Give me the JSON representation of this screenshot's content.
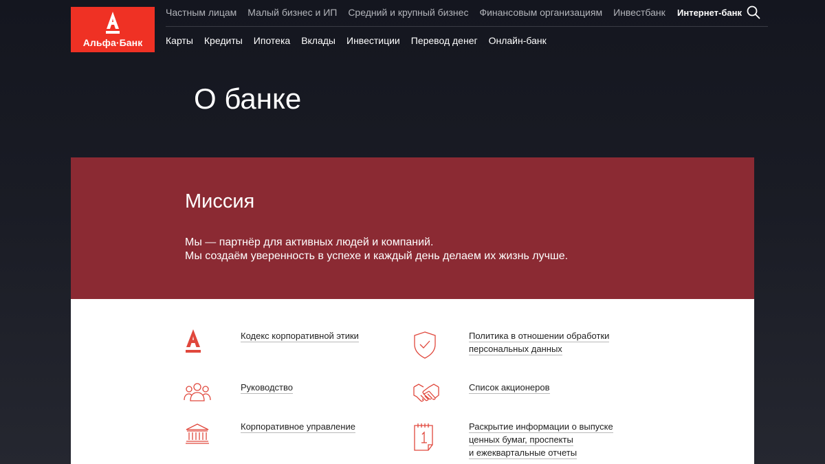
{
  "logo": {
    "text": "Альфа·Банк"
  },
  "nav_top": [
    "Частным лицам",
    "Малый бизнес и ИП",
    "Средний и крупный бизнес",
    "Финансовым организациям",
    "Инвестбанк"
  ],
  "internet_bank": "Интернет-банк",
  "nav_sub": [
    "Карты",
    "Кредиты",
    "Ипотека",
    "Вклады",
    "Инвестиции",
    "Перевод денег",
    "Онлайн-банк"
  ],
  "page_title": "О банке",
  "mission": {
    "heading": "Миссия",
    "line1": "Мы — партнёр для активных людей и компаний.",
    "line2": "Мы создаём уверенность в успехе и каждый день делаем их жизнь лучше."
  },
  "links": {
    "ethics": "Кодекс корпоративной этики",
    "management": "Руководство",
    "governance": "Корпоративное управление",
    "privacy_l1": "Политика в отношении обработки",
    "privacy_l2": "персональных данных",
    "shareholders": "Список акционеров",
    "disclosure_l1": "Раскрытие информации о выпуске",
    "disclosure_l2": "ценных бумаг, проспекты",
    "disclosure_l3": "и ежеквартальные отчеты"
  },
  "colors": {
    "brand_red": "#ef3124",
    "mission_bg": "#8b2a33",
    "icon_red": "#e0473c"
  },
  "icons": [
    "alfa-a-icon",
    "people-icon",
    "bank-building-icon",
    "shield-check-icon",
    "handshake-icon",
    "calendar-document-icon",
    "search-icon"
  ]
}
